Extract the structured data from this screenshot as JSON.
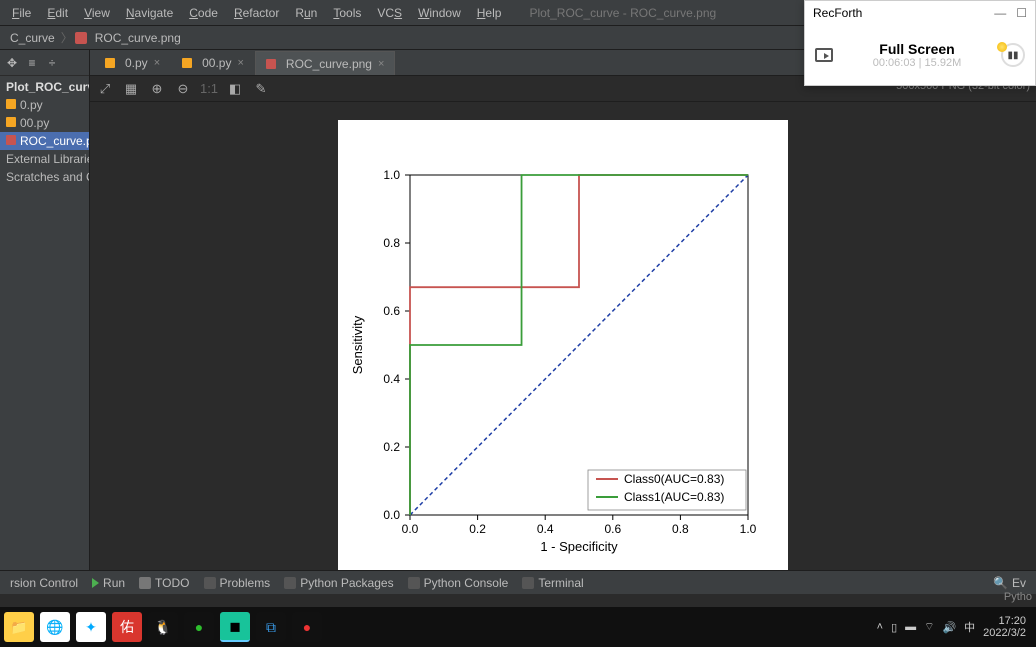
{
  "menu": {
    "file": "File",
    "edit": "Edit",
    "view": "View",
    "navigate": "Navigate",
    "code": "Code",
    "refactor": "Refactor",
    "run": "Run",
    "tools": "Tools",
    "vcs": "VCS",
    "window": "Window",
    "help": "Help"
  },
  "window_title": "Plot_ROC_curve - ROC_curve.png",
  "breadcrumb": {
    "root": "C_curve",
    "file": "ROC_curve.png"
  },
  "tree": {
    "root": "Plot_ROC_curve",
    "items": [
      "0.py",
      "00.py",
      "ROC_curve.png"
    ],
    "extra": [
      "External Libraries",
      "Scratches and Co"
    ]
  },
  "tabs": [
    {
      "label": "0.py",
      "active": false,
      "icon": "py"
    },
    {
      "label": "00.py",
      "active": false,
      "icon": "py"
    },
    {
      "label": "ROC_curve.png",
      "active": true,
      "icon": "img"
    }
  ],
  "image_info": "500x500 PNG (32-bit color)",
  "editor_tools": {
    "ratio": "1:1"
  },
  "bottom": {
    "version": "rsion Control",
    "run": "Run",
    "todo": "TODO",
    "problems": "Problems",
    "pypkg": "Python Packages",
    "pyconsole": "Python Console",
    "terminal": "Terminal",
    "event": "Ev",
    "lang": "Pytho"
  },
  "recforth": {
    "title": "RecForth",
    "fullscreen": "Full Screen",
    "time": "00:06:03",
    "size": "15.92M"
  },
  "tray": {
    "time": "17:20",
    "date": "2022/3/2",
    "ime": "中"
  },
  "chart_data": {
    "type": "line",
    "title": "",
    "xlabel": "1 - Specificity",
    "ylabel": "Sensitivity",
    "xticks": [
      0.0,
      0.2,
      0.4,
      0.6,
      0.8,
      1.0
    ],
    "yticks": [
      0.0,
      0.2,
      0.4,
      0.6,
      0.8,
      1.0
    ],
    "xlim": [
      0.0,
      1.0
    ],
    "ylim": [
      0.0,
      1.0
    ],
    "series": [
      {
        "name": "Class0(AUC=0.83)",
        "color": "#c75450",
        "points": [
          [
            0.0,
            0.0
          ],
          [
            0.0,
            0.67
          ],
          [
            0.5,
            0.67
          ],
          [
            0.5,
            1.0
          ],
          [
            1.0,
            1.0
          ]
        ]
      },
      {
        "name": "Class1(AUC=0.83)",
        "color": "#3a9d3a",
        "points": [
          [
            0.0,
            0.0
          ],
          [
            0.0,
            0.5
          ],
          [
            0.33,
            0.5
          ],
          [
            0.33,
            1.0
          ],
          [
            1.0,
            1.0
          ]
        ]
      }
    ],
    "reference": {
      "name": "diagonal",
      "color": "#1f3fa6",
      "style": "dashed",
      "points": [
        [
          0.0,
          0.0
        ],
        [
          1.0,
          1.0
        ]
      ]
    },
    "legend_position": "lower right"
  }
}
